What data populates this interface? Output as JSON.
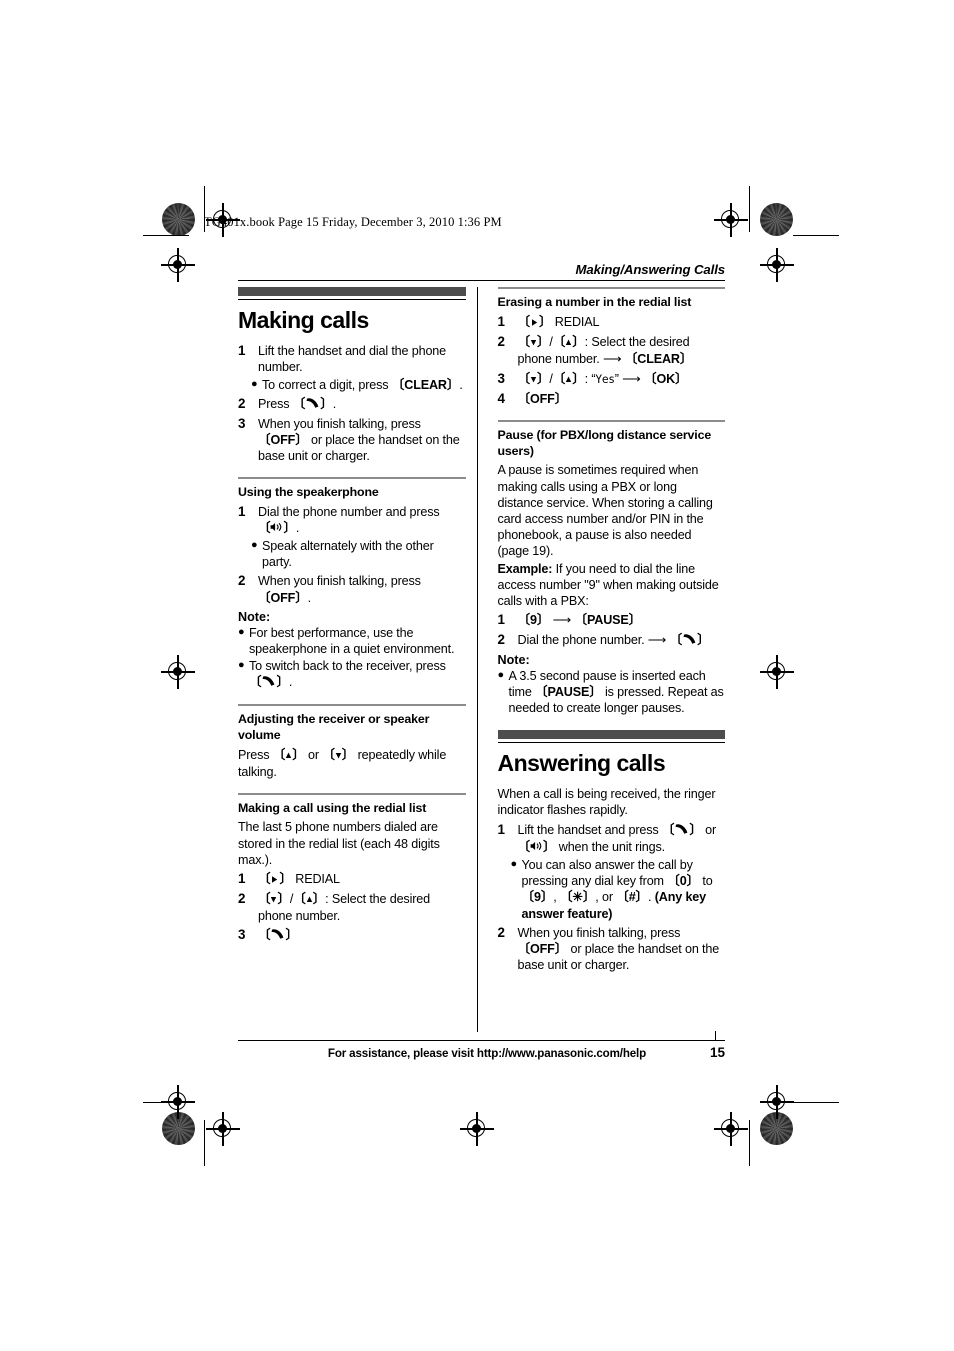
{
  "file_stamp": "TG401x.book  Page 15  Friday, December 3, 2010  1:36 PM",
  "running_head": "Making/Answering Calls",
  "footer": {
    "assistance": "For assistance, please visit http://www.panasonic.com/help",
    "page_number": "15"
  },
  "colors": {
    "chapter_bar": "#4d4d4d",
    "sub_rule": "#8c8c8c",
    "rule": "#000000"
  },
  "left_column": {
    "chapter_title": "Making calls",
    "steps": [
      {
        "num": "1",
        "text_a": "Lift the handset and dial the phone number."
      },
      {
        "num": "2",
        "text_a": "Press "
      },
      {
        "num": "3",
        "text_a": "When you finish talking, press ",
        "text_b": " or place the handset on the base unit or charger."
      }
    ],
    "step1_bullet": {
      "text_a": "To correct a digit, press ",
      "key": "CLEAR",
      "text_b": "."
    },
    "key_clear": "CLEAR",
    "key_off": "OFF",
    "speakerphone": {
      "title": "Using the speakerphone",
      "step1": {
        "num": "1",
        "text": "Dial the phone number and press "
      },
      "step1_bullet": "Speak alternately with the other party.",
      "step2": {
        "num": "2",
        "text": "When you finish talking, press "
      },
      "note_label": "Note:",
      "note1": "For best performance, use the speakerphone in a quiet environment.",
      "note2_a": "To switch back to the receiver, press "
    },
    "volume": {
      "title": "Adjusting the receiver or speaker volume",
      "text_a": "Press ",
      "text_b": " or ",
      "text_c": " repeatedly while talking."
    },
    "redial": {
      "title": "Making a call using the redial list",
      "intro": "The last 5 phone numbers dialed are stored in the redial list (each 48 digits max.).",
      "step1_label": "REDIAL",
      "step2_text": ": Select the desired phone number."
    }
  },
  "right_column": {
    "erasing": {
      "title": "Erasing a number in the redial list",
      "step1_label": "REDIAL",
      "step2_text": ": Select the desired phone number. ",
      "step2_key": "CLEAR",
      "step3_text": ": ",
      "step3_lcd": "Yes",
      "step3_key": "OK",
      "step4_key": "OFF"
    },
    "pause": {
      "title": "Pause (for PBX/long distance service users)",
      "body": "A pause is sometimes required when making calls using a PBX or long distance service. When storing a calling card access number and/or PIN in the phonebook, a pause is also needed (page 19).",
      "example_label": "Example:",
      "example_text": " If you need to dial the line access number \"9\" when making outside calls with a PBX:",
      "step1_key_a": "9",
      "step1_key_b": "PAUSE",
      "step2_text": "Dial the phone number. ",
      "note_label": "Note:",
      "note_a": "A 3.5 second pause is inserted each time ",
      "note_key": "PAUSE",
      "note_b": " is pressed. Repeat as needed to create longer pauses."
    },
    "answering": {
      "chapter_title": "Answering calls",
      "intro": "When a call is being received, the ringer indicator flashes rapidly.",
      "step1_a": "Lift the handset and press ",
      "step1_b": " or ",
      "step1_c": " when the unit rings.",
      "step1_bullet_a": "You can also answer the call by pressing any dial key from ",
      "step1_bullet_key0": "0",
      "step1_bullet_b": " to ",
      "step1_bullet_key9": "9",
      "step1_bullet_c": ", ",
      "step1_bullet_keystar": "✳",
      "step1_bullet_d": ", or ",
      "step1_bullet_keyhash": "#",
      "step1_bullet_e": ". ",
      "step1_bullet_bold": "(Any key answer feature)",
      "step2_a": "When you finish talking, press ",
      "step2_key": "OFF",
      "step2_b": " or place the handset on the base unit or charger."
    }
  },
  "icons": {
    "talk_key": "handset-talk-icon",
    "speakerphone_key": "speakerphone-icon",
    "nav_right": "nav-right-icon",
    "nav_down": "nav-down-icon",
    "nav_up": "nav-up-icon",
    "arrow_right": "arrow-right-icon",
    "registration_mark": "registration-mark-icon",
    "halftone_patch": "halftone-patch-icon"
  }
}
